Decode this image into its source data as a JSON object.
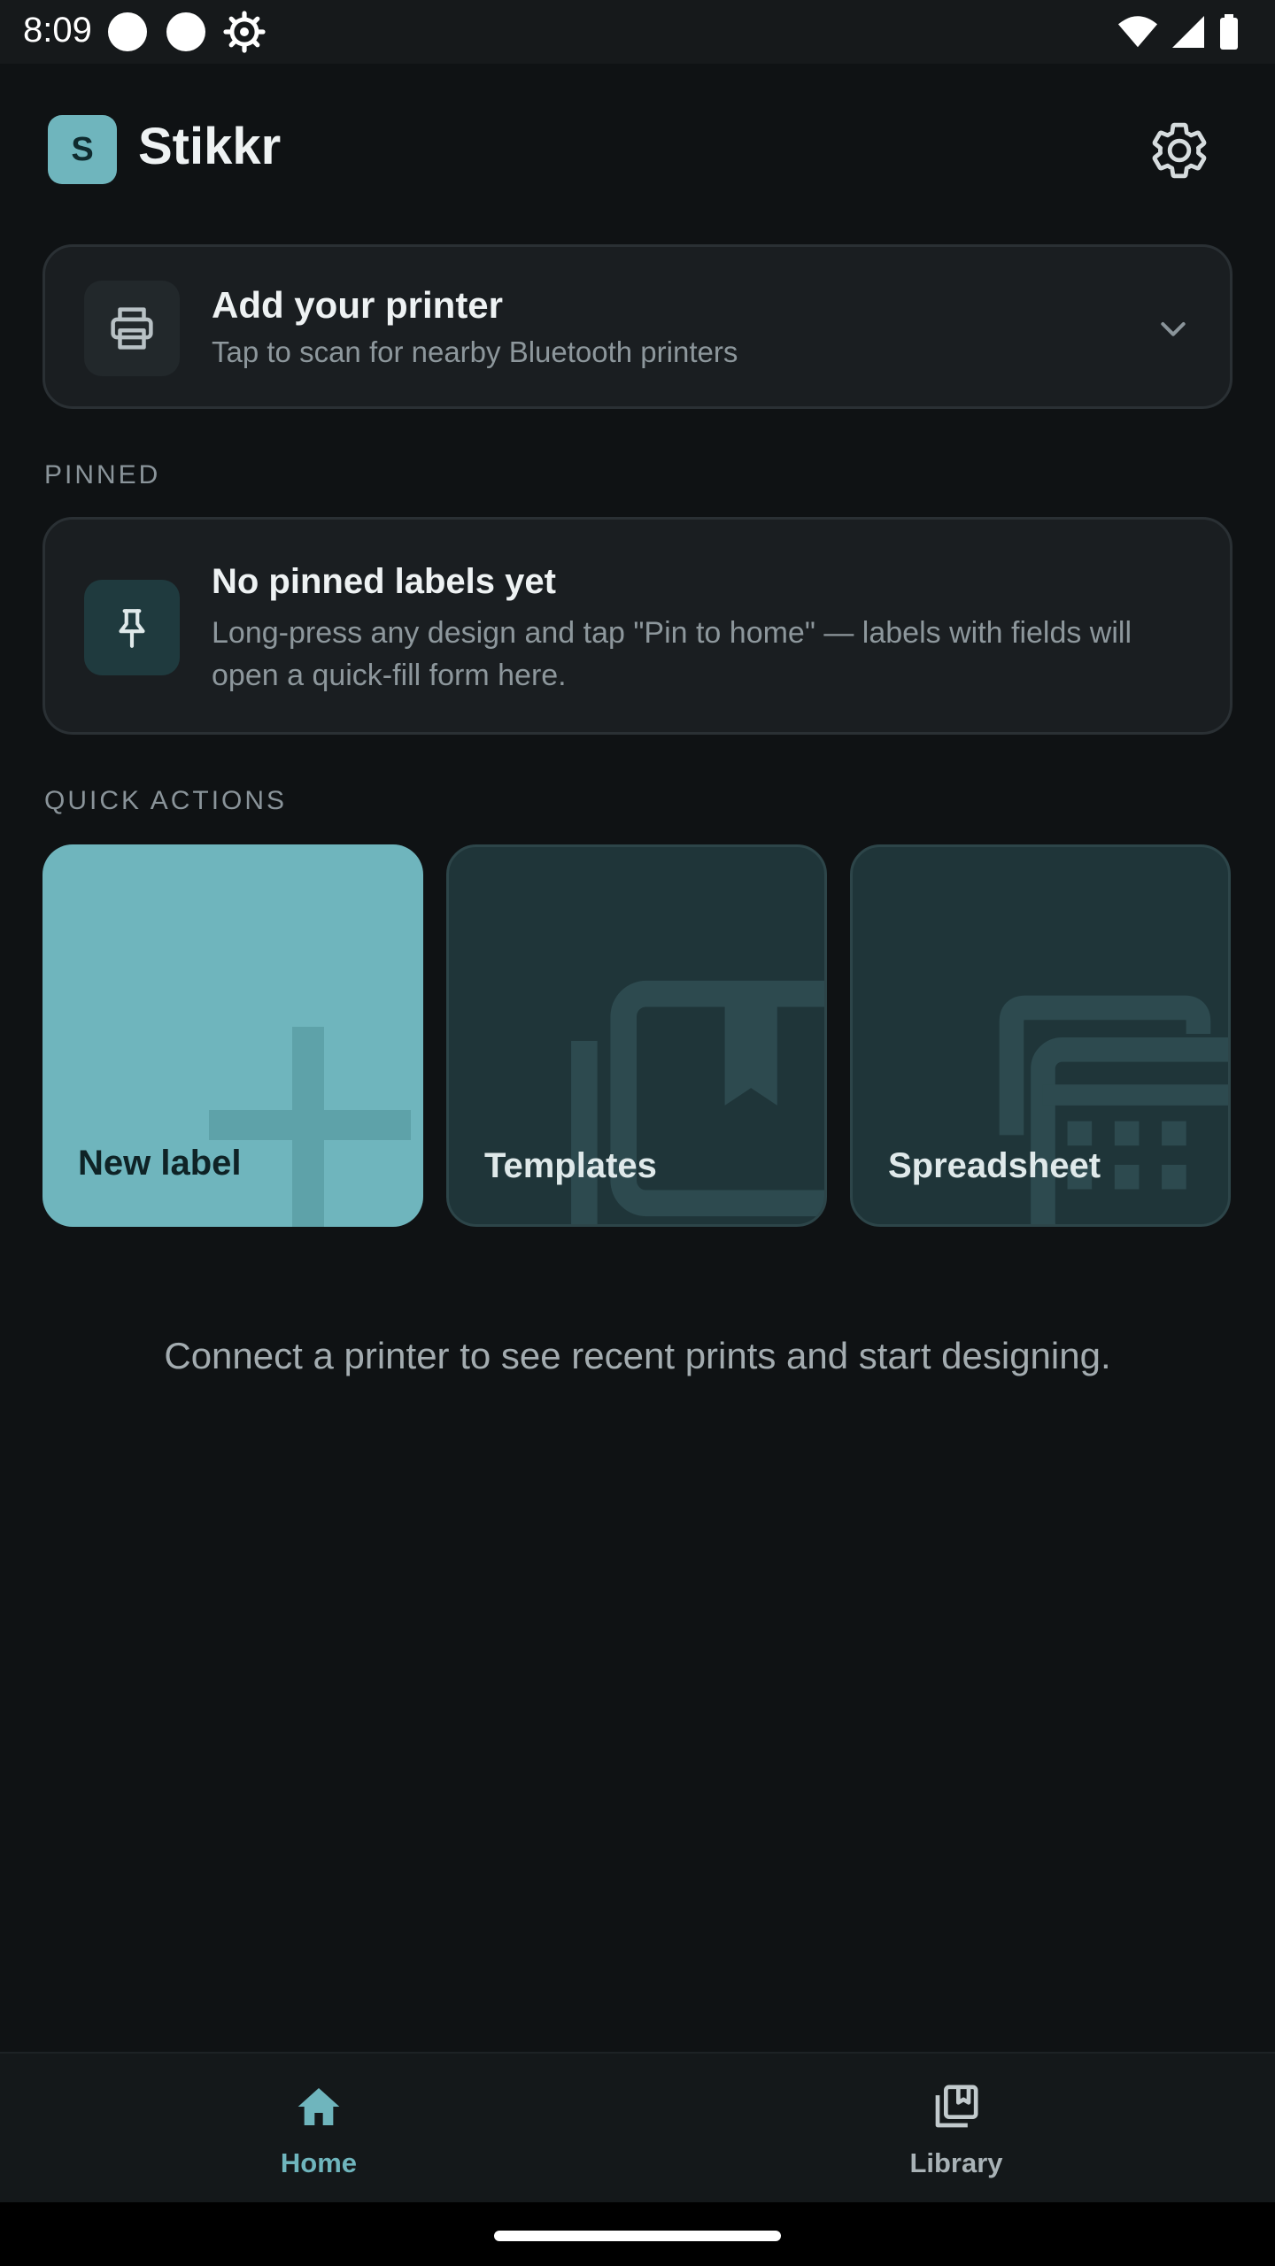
{
  "status_bar": {
    "time": "8:09",
    "icons_left": [
      "circle-icon",
      "circle-icon",
      "gear-icon"
    ],
    "icons_right": [
      "wifi-icon",
      "signal-icon",
      "battery-icon"
    ]
  },
  "header": {
    "logo_letter": "S",
    "title": "Stikkr",
    "settings_icon": "gear-icon"
  },
  "printer_card": {
    "icon": "printer-icon",
    "title": "Add your printer",
    "subtitle": "Tap to scan for nearby Bluetooth printers",
    "chevron_icon": "chevron-down-icon"
  },
  "pinned": {
    "section_label": "PINNED",
    "icon": "pin-icon",
    "title": "No pinned labels yet",
    "body": "Long-press any design and tap \"Pin to home\" — labels with fields will open a quick-fill form here."
  },
  "quick_actions": {
    "section_label": "QUICK ACTIONS",
    "items": [
      {
        "label": "New label",
        "icon": "plus-icon"
      },
      {
        "label": "Templates",
        "icon": "book-bookmark-icon"
      },
      {
        "label": "Spreadsheet",
        "icon": "table-icon"
      }
    ]
  },
  "empty_message": "Connect a printer to see recent prints and start designing.",
  "bottom_nav": {
    "items": [
      {
        "label": "Home",
        "icon": "home-icon",
        "active": true
      },
      {
        "label": "Library",
        "icon": "library-icon",
        "active": false
      }
    ]
  },
  "colors": {
    "background": "#0f1214",
    "accent": "#6fb5bd",
    "card": "#1a1e21",
    "muted_text": "#8d979c"
  }
}
